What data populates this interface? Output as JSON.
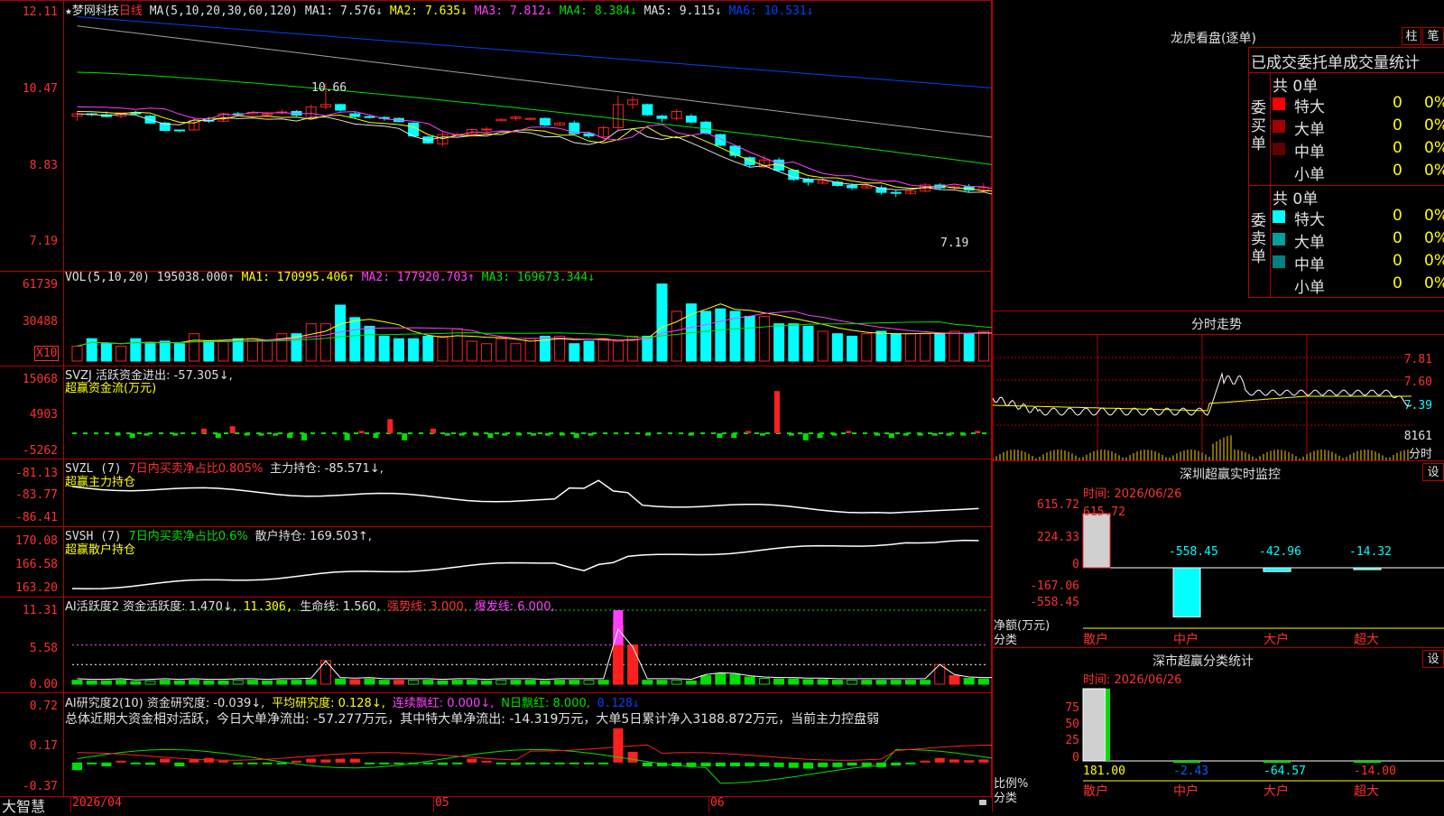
{
  "stock": {
    "star": "★",
    "name": "梦网科技",
    "period": "日线",
    "logo": "大智慧"
  },
  "colors": {
    "up": "#ff2020",
    "down": "#00ffff",
    "ma1": "#e0e0e0",
    "ma2": "#ffff00",
    "ma3": "#ff40ff",
    "ma4": "#00e000",
    "ma5": "#a0a0a0",
    "ma6": "#0040ff"
  },
  "main": {
    "header_prefix": "MA(5,10,20,30,60,120)",
    "ma": [
      {
        "label": "MA1:",
        "value": "7.576↓"
      },
      {
        "label": "MA2:",
        "value": "7.635↓"
      },
      {
        "label": "MA3:",
        "value": "7.812↓"
      },
      {
        "label": "MA4:",
        "value": "8.384↓"
      },
      {
        "label": "MA5:",
        "value": "9.115↓"
      },
      {
        "label": "MA6:",
        "value": "10.531↓"
      }
    ],
    "yticks": [
      "12.11",
      "10.47",
      "8.83",
      "7.19"
    ],
    "annot_high": "10.66",
    "annot_low": "7.19"
  },
  "vol": {
    "header": [
      {
        "t": "VOL(5,10,20)",
        "c": "w"
      },
      {
        "t": "195038.000↑",
        "c": "w"
      },
      {
        "t": "MA1: 170995.406↑",
        "c": "y"
      },
      {
        "t": "MA2: 177920.703↑",
        "c": "m"
      },
      {
        "t": "MA3: 169673.344↓",
        "c": "g"
      }
    ],
    "yticks": [
      "61739",
      "30488"
    ],
    "unit": "X10"
  },
  "svzj": {
    "header": [
      {
        "t": "SVZJ  活跃资金进出: -57.305↓,",
        "c": "w"
      }
    ],
    "sub": "超赢资金流(万元)",
    "yticks": [
      "15068",
      "4903",
      "-5262"
    ]
  },
  "svzl": {
    "header": [
      {
        "t": "SVZL (7)",
        "c": "w"
      },
      {
        "t": "7日内买卖净占比0.805%",
        "c": "r"
      },
      {
        "t": "主力持仓: -85.571↓,",
        "c": "w"
      }
    ],
    "sub": "超赢主力持仓",
    "yticks": [
      "-81.13",
      "-83.77",
      "-86.41"
    ]
  },
  "svsh": {
    "header": [
      {
        "t": "SVSH (7)",
        "c": "w"
      },
      {
        "t": "7日内买卖净占比0.6%",
        "c": "g"
      },
      {
        "t": "散户持仓: 169.503↑,",
        "c": "w"
      }
    ],
    "sub": "超赢散户持仓",
    "yticks": [
      "170.08",
      "166.58",
      "163.20"
    ]
  },
  "ai2": {
    "header": [
      {
        "t": "AI活跃度2 资金活跃度: 1.470↓,",
        "c": "w"
      },
      {
        "t": "11.306,",
        "c": "y"
      },
      {
        "t": "生命线: 1.560,",
        "c": "w"
      },
      {
        "t": "强势线: 3.000,",
        "c": "r"
      },
      {
        "t": "爆发线: 6.000,",
        "c": "m"
      }
    ],
    "yticks": [
      "11.31",
      "5.58",
      "0.00"
    ]
  },
  "ai3": {
    "header": [
      {
        "t": "AI研究度2(10) 资金研究度: -0.039↓,",
        "c": "w"
      },
      {
        "t": "平均研究度: 0.128↓,",
        "c": "y"
      },
      {
        "t": "连续飘红: 0.000↓,",
        "c": "m"
      },
      {
        "t": "N日飘红: 8.000,",
        "c": "g"
      },
      {
        "t": "0.128↓",
        "c": "b"
      }
    ],
    "comment": "总体近期大资金相对活跃，今日大单净流出: -57.277万元，其中特大单净流出: -14.319万元，大单5日累计净入3188.872万元，当前主力控盘弱",
    "yticks": [
      "0.72",
      "0.17",
      "-0.37"
    ]
  },
  "xaxis": {
    "labels": [
      "2026/04",
      "05",
      "06"
    ]
  },
  "right": {
    "dragon_title": "龙虎看盘(逐单)",
    "btn_zhu": "柱",
    "btn_bi": "笔",
    "stats_title": "已成交委托单成交量统计",
    "buy_label": "委买单",
    "sell_label": "委卖单",
    "buy_total": "共 0单",
    "sell_total": "共 0单",
    "buy_rows": [
      {
        "name": "特大",
        "count": "0",
        "pct": "0%",
        "color": "#ff0000"
      },
      {
        "name": "大单",
        "count": "0",
        "pct": "0%",
        "color": "#a00000"
      },
      {
        "name": "中单",
        "count": "0",
        "pct": "0%",
        "color": "#600000"
      },
      {
        "name": "小单",
        "count": "0",
        "pct": "0%",
        "color": ""
      }
    ],
    "sell_rows": [
      {
        "name": "特大",
        "count": "0",
        "pct": "0%",
        "color": "#00ffff"
      },
      {
        "name": "大单",
        "count": "0",
        "pct": "0%",
        "color": "#00a0a0"
      },
      {
        "name": "中单",
        "count": "0",
        "pct": "0%",
        "color": "#008080"
      },
      {
        "name": "小单",
        "count": "0",
        "pct": "0%",
        "color": ""
      }
    ],
    "intraday_title": "分时走势",
    "intraday_yticks": [
      "7.81",
      "7.60",
      "7.39"
    ],
    "intraday_vol": "8161",
    "intraday_unit": "分时",
    "sz_monitor_title": "深圳超赢实时监控",
    "sz_btn": "设",
    "sz_time": "时间: 2026/06/26",
    "sz_yticks": [
      "615.72",
      "224.33",
      "0",
      "-167.06",
      "-558.45"
    ],
    "sz_unit": "净额(万元)",
    "sz_cls": "分类",
    "sz_values": [
      "615.72",
      "-558.45",
      "-42.96",
      "-14.32"
    ],
    "cats": [
      "散户",
      "中户",
      "大户",
      "超大"
    ],
    "stat_title": "深市超赢分类统计",
    "stat_btn": "设",
    "stat_time": "时间: 2026/06/26",
    "stat_yticks": [
      "75",
      "50",
      "25",
      "0"
    ],
    "stat_unit": "比例%",
    "stat_cls": "分类",
    "stat_values": [
      "181.00",
      "-2.43",
      "-64.57",
      "-14.00"
    ]
  },
  "chart_data": [
    {
      "type": "candlestick",
      "title": "梦网科技 日线",
      "ylim": [
        7.19,
        12.11
      ],
      "candles": [
        [
          9.95,
          10.05,
          9.85,
          10.0
        ],
        [
          10.0,
          10.02,
          9.95,
          9.98
        ],
        [
          9.98,
          10.05,
          9.92,
          9.94
        ],
        [
          9.95,
          10.0,
          9.9,
          10.02
        ],
        [
          10.02,
          10.06,
          9.98,
          10.0
        ],
        [
          9.95,
          9.98,
          9.78,
          9.8
        ],
        [
          9.8,
          9.83,
          9.62,
          9.64
        ],
        [
          9.65,
          9.66,
          9.6,
          9.63
        ],
        [
          9.65,
          9.9,
          9.64,
          9.86
        ],
        [
          9.86,
          9.9,
          9.8,
          9.84
        ],
        [
          9.84,
          10.02,
          9.82,
          10.0
        ],
        [
          10.0,
          10.04,
          9.95,
          9.98
        ],
        [
          10.0,
          10.05,
          9.98,
          10.03
        ],
        [
          9.97,
          10.04,
          9.95,
          10.0
        ],
        [
          10.02,
          10.1,
          9.98,
          10.04
        ],
        [
          10.05,
          10.08,
          9.95,
          9.97
        ],
        [
          9.9,
          10.2,
          9.88,
          10.15
        ],
        [
          10.15,
          10.66,
          10.1,
          10.2
        ],
        [
          10.2,
          10.22,
          10.05,
          10.08
        ],
        [
          10.0,
          10.05,
          9.9,
          9.94
        ],
        [
          9.94,
          9.96,
          9.9,
          9.92
        ],
        [
          9.92,
          9.95,
          9.85,
          9.9
        ],
        [
          9.9,
          9.92,
          9.82,
          9.83
        ],
        [
          9.8,
          9.82,
          9.5,
          9.52
        ],
        [
          9.5,
          9.52,
          9.35,
          9.37
        ],
        [
          9.35,
          9.6,
          9.3,
          9.55
        ],
        [
          9.55,
          9.6,
          9.52,
          9.56
        ],
        [
          9.56,
          9.68,
          9.55,
          9.66
        ],
        [
          9.66,
          9.72,
          9.6,
          9.67
        ],
        [
          9.85,
          9.9,
          9.84,
          9.88
        ],
        [
          9.9,
          9.95,
          9.85,
          9.93
        ],
        [
          9.9,
          9.92,
          9.88,
          9.9
        ],
        [
          9.9,
          9.92,
          9.74,
          9.76
        ],
        [
          9.76,
          9.82,
          9.74,
          9.8
        ],
        [
          9.8,
          9.85,
          9.55,
          9.57
        ],
        [
          9.57,
          9.6,
          9.48,
          9.52
        ],
        [
          9.5,
          9.75,
          9.45,
          9.7
        ],
        [
          9.7,
          10.4,
          9.65,
          10.2
        ],
        [
          10.2,
          10.38,
          10.1,
          10.3
        ],
        [
          10.2,
          10.22,
          9.95,
          9.98
        ],
        [
          9.95,
          9.98,
          9.82,
          9.9
        ],
        [
          9.9,
          10.1,
          9.85,
          10.05
        ],
        [
          9.95,
          10.0,
          9.8,
          9.82
        ],
        [
          9.82,
          9.85,
          9.55,
          9.58
        ],
        [
          9.55,
          9.57,
          9.3,
          9.32
        ],
        [
          9.3,
          9.32,
          9.05,
          9.1
        ],
        [
          9.05,
          9.08,
          8.85,
          8.9
        ],
        [
          8.85,
          9.1,
          8.82,
          9.0
        ],
        [
          9.0,
          9.05,
          8.75,
          8.78
        ],
        [
          8.78,
          8.8,
          8.55,
          8.58
        ],
        [
          8.58,
          8.62,
          8.45,
          8.52
        ],
        [
          8.5,
          8.6,
          8.48,
          8.55
        ],
        [
          8.52,
          8.56,
          8.42,
          8.45
        ],
        [
          8.45,
          8.5,
          8.35,
          8.4
        ],
        [
          8.4,
          8.48,
          8.38,
          8.44
        ],
        [
          8.4,
          8.45,
          8.25,
          8.3
        ],
        [
          8.3,
          8.34,
          8.2,
          8.28
        ],
        [
          8.28,
          8.35,
          8.25,
          8.33
        ],
        [
          8.33,
          8.5,
          8.3,
          8.46
        ],
        [
          8.46,
          8.5,
          8.35,
          8.4
        ],
        [
          8.4,
          8.44,
          8.36,
          8.42
        ],
        [
          8.42,
          8.48,
          8.3,
          8.35
        ],
        [
          8.35,
          8.5,
          8.33,
          8.4
        ],
        [
          8.4,
          8.45,
          8.25,
          8.28
        ],
        [
          8.28,
          8.32,
          8.22,
          8.25
        ],
        [
          8.25,
          8.3,
          8.05,
          8.08
        ]
      ],
      "ma_series": [
        {
          "name": "MA1",
          "start": 10.0,
          "end": 8.1
        },
        {
          "name": "MA2",
          "start": 10.1,
          "end": 8.2
        },
        {
          "name": "MA3",
          "start": 10.3,
          "end": 8.3
        },
        {
          "name": "MA4",
          "start": 10.9,
          "end": 8.8
        },
        {
          "name": "MA5",
          "start": 11.9,
          "end": 9.4
        },
        {
          "name": "MA6",
          "start": 12.1,
          "end": 10.5
        }
      ]
    },
    {
      "type": "bar",
      "title": "VOL(5,10,20)",
      "ylim": [
        0,
        61739
      ],
      "values": [
        12,
        18,
        14,
        12,
        18,
        14,
        16,
        14,
        22,
        16,
        16,
        18,
        18,
        16,
        22,
        22,
        30,
        30,
        45,
        35,
        28,
        20,
        18,
        18,
        20,
        20,
        26,
        16,
        14,
        18,
        14,
        18,
        20,
        20,
        14,
        16,
        18,
        16,
        20,
        20,
        62,
        40,
        46,
        40,
        42,
        40,
        36,
        36,
        30,
        30,
        28,
        24,
        22,
        20,
        22,
        24,
        22,
        22,
        22,
        22,
        24,
        22,
        24,
        20,
        18,
        22
      ]
    },
    {
      "type": "bar",
      "title": "SVZJ",
      "ylim": [
        -5262,
        15068
      ],
      "values": [
        0,
        0,
        0,
        -1,
        -2,
        -1,
        0,
        -1,
        0,
        2,
        -2,
        3,
        -1,
        -1,
        -1,
        -2,
        -3,
        0,
        0,
        -3,
        1,
        -2,
        6,
        -3,
        0,
        2,
        -1,
        -1,
        -1,
        -2,
        -1,
        -1,
        -1,
        -1,
        -1,
        -2,
        -1,
        0,
        0,
        0,
        -1,
        0,
        0,
        -1,
        0,
        -2,
        -2,
        1,
        -1,
        18,
        -1,
        -3,
        -2,
        -1,
        1,
        0,
        -1,
        -2,
        -1,
        -1,
        -1,
        -1,
        -1,
        1,
        0,
        1,
        0,
        0,
        -1,
        2
      ]
    },
    {
      "type": "line",
      "title": "SVZL",
      "ylim": [
        -86.41,
        -81.13
      ]
    },
    {
      "type": "line",
      "title": "SVSH",
      "ylim": [
        163.2,
        170.08
      ]
    },
    {
      "type": "bar",
      "title": "AI活跃度2",
      "ylim": [
        0,
        11.31
      ]
    },
    {
      "type": "bar",
      "title": "AI研究度2(10)",
      "ylim": [
        -0.37,
        0.72
      ]
    },
    {
      "type": "bar",
      "title": "深圳超赢实时监控",
      "categories": [
        "散户",
        "中户",
        "大户",
        "超大"
      ],
      "values": [
        615.72,
        -558.45,
        -42.96,
        -14.32
      ]
    },
    {
      "type": "bar",
      "title": "深市超赢分类统计",
      "categories": [
        "散户",
        "中户",
        "大户",
        "超大"
      ],
      "values": [
        181.0,
        -2.43,
        -64.57,
        -14.0
      ]
    }
  ]
}
